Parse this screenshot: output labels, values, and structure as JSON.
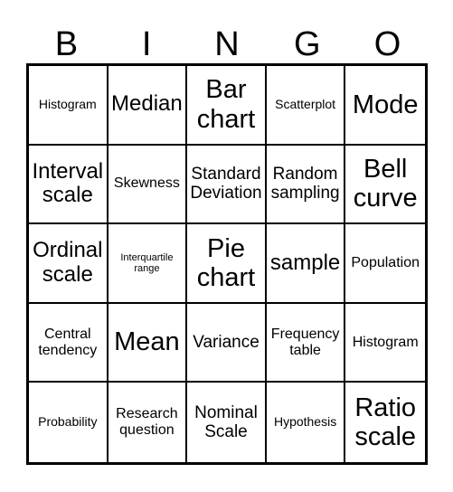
{
  "card": {
    "title_letters": [
      "B",
      "I",
      "N",
      "G",
      "O"
    ],
    "columns": 5,
    "rows": 5,
    "border_color": "#000000",
    "background_color": "#ffffff",
    "text_color": "#000000",
    "cells": [
      {
        "text": "Histogram",
        "size": "sm"
      },
      {
        "text": "Median",
        "size": "xl"
      },
      {
        "text": "Bar chart",
        "size": "xxl"
      },
      {
        "text": "Scatterplot",
        "size": "sm"
      },
      {
        "text": "Mode",
        "size": "xxl"
      },
      {
        "text": "Interval scale",
        "size": "xl"
      },
      {
        "text": "Skewness",
        "size": "md"
      },
      {
        "text": "Standard Deviation",
        "size": "lg"
      },
      {
        "text": "Random sampling",
        "size": "lg"
      },
      {
        "text": "Bell curve",
        "size": "xxl"
      },
      {
        "text": "Ordinal scale",
        "size": "xl"
      },
      {
        "text": "Interquartile range",
        "size": "xs"
      },
      {
        "text": "Pie chart",
        "size": "xxl"
      },
      {
        "text": "sample",
        "size": "xl"
      },
      {
        "text": "Population",
        "size": "md"
      },
      {
        "text": "Central tendency",
        "size": "md"
      },
      {
        "text": "Mean",
        "size": "xxl"
      },
      {
        "text": "Variance",
        "size": "lg"
      },
      {
        "text": "Frequency table",
        "size": "md"
      },
      {
        "text": "Histogram",
        "size": "md"
      },
      {
        "text": "Probability",
        "size": "sm"
      },
      {
        "text": "Research question",
        "size": "md"
      },
      {
        "text": "Nominal Scale",
        "size": "lg"
      },
      {
        "text": "Hypothesis",
        "size": "sm"
      },
      {
        "text": "Ratio scale",
        "size": "xxl"
      }
    ]
  }
}
